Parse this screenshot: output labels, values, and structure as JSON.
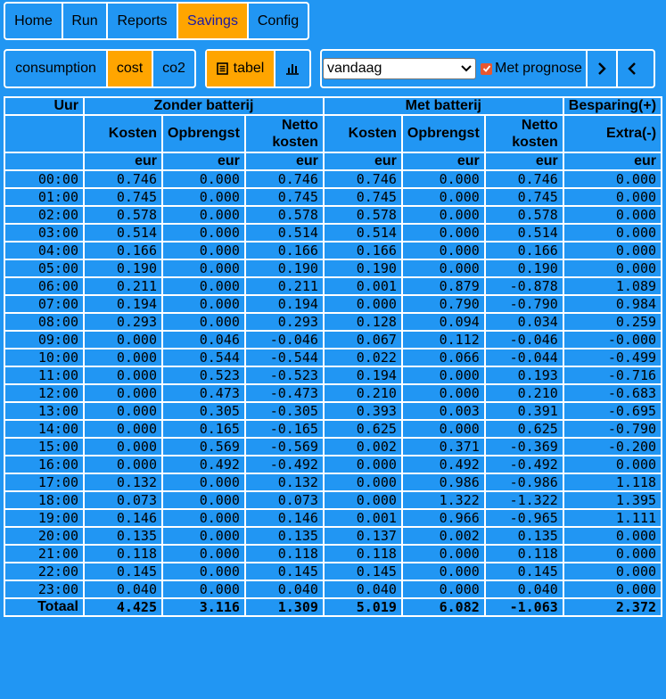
{
  "menu": [
    {
      "label": "Home",
      "active": false
    },
    {
      "label": "Run",
      "active": false
    },
    {
      "label": "Reports",
      "active": false
    },
    {
      "label": "Savings",
      "active": true
    },
    {
      "label": "Config",
      "active": false
    }
  ],
  "metric_tabs": [
    {
      "label": "consumption",
      "active": false
    },
    {
      "label": "cost",
      "active": true
    },
    {
      "label": "co2",
      "active": false
    }
  ],
  "view_tabs": [
    {
      "label": "tabel",
      "icon": "list-icon",
      "active": true
    },
    {
      "label": "",
      "icon": "bar-chart-icon",
      "active": false
    }
  ],
  "period_select": {
    "value": "vandaag"
  },
  "forecast_checkbox": {
    "label": "Met prognose",
    "checked": true
  },
  "colors": {
    "background": "#2196f3",
    "accent": "#ffa500",
    "checkbox": "#e8572f"
  },
  "table": {
    "groups": {
      "hour": "Uur",
      "without": "Zonder batterij",
      "with": "Met batterij",
      "savings": "Besparing(+)"
    },
    "subheaders": {
      "cost": "Kosten",
      "revenue": "Opbrengst",
      "net1": "Netto",
      "net2": "kosten",
      "extra": "Extra(-)"
    },
    "unit": "eur",
    "rows": [
      [
        "00:00",
        "0.746",
        "0.000",
        "0.746",
        "0.746",
        "0.000",
        "0.746",
        "0.000"
      ],
      [
        "01:00",
        "0.745",
        "0.000",
        "0.745",
        "0.745",
        "0.000",
        "0.745",
        "0.000"
      ],
      [
        "02:00",
        "0.578",
        "0.000",
        "0.578",
        "0.578",
        "0.000",
        "0.578",
        "0.000"
      ],
      [
        "03:00",
        "0.514",
        "0.000",
        "0.514",
        "0.514",
        "0.000",
        "0.514",
        "0.000"
      ],
      [
        "04:00",
        "0.166",
        "0.000",
        "0.166",
        "0.166",
        "0.000",
        "0.166",
        "0.000"
      ],
      [
        "05:00",
        "0.190",
        "0.000",
        "0.190",
        "0.190",
        "0.000",
        "0.190",
        "0.000"
      ],
      [
        "06:00",
        "0.211",
        "0.000",
        "0.211",
        "0.001",
        "0.879",
        "-0.878",
        "1.089"
      ],
      [
        "07:00",
        "0.194",
        "0.000",
        "0.194",
        "0.000",
        "0.790",
        "-0.790",
        "0.984"
      ],
      [
        "08:00",
        "0.293",
        "0.000",
        "0.293",
        "0.128",
        "0.094",
        "0.034",
        "0.259"
      ],
      [
        "09:00",
        "0.000",
        "0.046",
        "-0.046",
        "0.067",
        "0.112",
        "-0.046",
        "-0.000"
      ],
      [
        "10:00",
        "0.000",
        "0.544",
        "-0.544",
        "0.022",
        "0.066",
        "-0.044",
        "-0.499"
      ],
      [
        "11:00",
        "0.000",
        "0.523",
        "-0.523",
        "0.194",
        "0.000",
        "0.193",
        "-0.716"
      ],
      [
        "12:00",
        "0.000",
        "0.473",
        "-0.473",
        "0.210",
        "0.000",
        "0.210",
        "-0.683"
      ],
      [
        "13:00",
        "0.000",
        "0.305",
        "-0.305",
        "0.393",
        "0.003",
        "0.391",
        "-0.695"
      ],
      [
        "14:00",
        "0.000",
        "0.165",
        "-0.165",
        "0.625",
        "0.000",
        "0.625",
        "-0.790"
      ],
      [
        "15:00",
        "0.000",
        "0.569",
        "-0.569",
        "0.002",
        "0.371",
        "-0.369",
        "-0.200"
      ],
      [
        "16:00",
        "0.000",
        "0.492",
        "-0.492",
        "0.000",
        "0.492",
        "-0.492",
        "0.000"
      ],
      [
        "17:00",
        "0.132",
        "0.000",
        "0.132",
        "0.000",
        "0.986",
        "-0.986",
        "1.118"
      ],
      [
        "18:00",
        "0.073",
        "0.000",
        "0.073",
        "0.000",
        "1.322",
        "-1.322",
        "1.395"
      ],
      [
        "19:00",
        "0.146",
        "0.000",
        "0.146",
        "0.001",
        "0.966",
        "-0.965",
        "1.111"
      ],
      [
        "20:00",
        "0.135",
        "0.000",
        "0.135",
        "0.137",
        "0.002",
        "0.135",
        "0.000"
      ],
      [
        "21:00",
        "0.118",
        "0.000",
        "0.118",
        "0.118",
        "0.000",
        "0.118",
        "0.000"
      ],
      [
        "22:00",
        "0.145",
        "0.000",
        "0.145",
        "0.145",
        "0.000",
        "0.145",
        "0.000"
      ],
      [
        "23:00",
        "0.040",
        "0.000",
        "0.040",
        "0.040",
        "0.000",
        "0.040",
        "0.000"
      ]
    ],
    "total": [
      "Totaal",
      "4.425",
      "3.116",
      "1.309",
      "5.019",
      "6.082",
      "-1.063",
      "2.372"
    ]
  }
}
